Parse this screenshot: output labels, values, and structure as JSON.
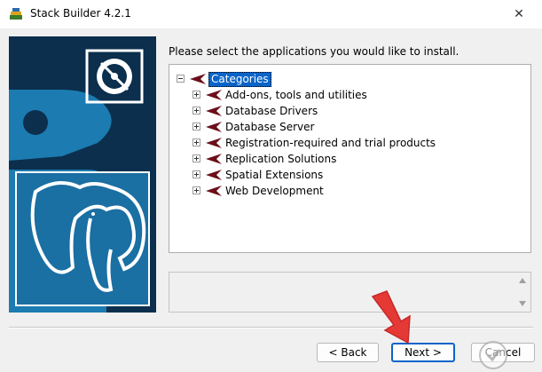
{
  "window": {
    "title": "Stack Builder 4.2.1",
    "close_glyph": "✕"
  },
  "heading": "Please select the applications you would like to install.",
  "tree": {
    "root_label": "Categories",
    "items": [
      {
        "label": "Add-ons, tools and utilities"
      },
      {
        "label": "Database Drivers"
      },
      {
        "label": "Database Server"
      },
      {
        "label": "Registration-required and trial products"
      },
      {
        "label": "Replication Solutions"
      },
      {
        "label": "Spatial Extensions"
      },
      {
        "label": "Web Development"
      }
    ]
  },
  "buttons": {
    "back": "< Back",
    "next": "Next >",
    "cancel": "Cancel"
  },
  "colors": {
    "accent": "#0a64c8",
    "sidebar": "#0b2f4d",
    "flag": "#6b0f1a",
    "arrow": "#e53935"
  },
  "icons": {
    "sidebar_disc": "disc-icon",
    "sidebar_logo": "postgresql-elephant-icon",
    "flag": "flag-icon",
    "pointer": "red-arrow-icon",
    "watermark": "watermark-logo-icon"
  }
}
